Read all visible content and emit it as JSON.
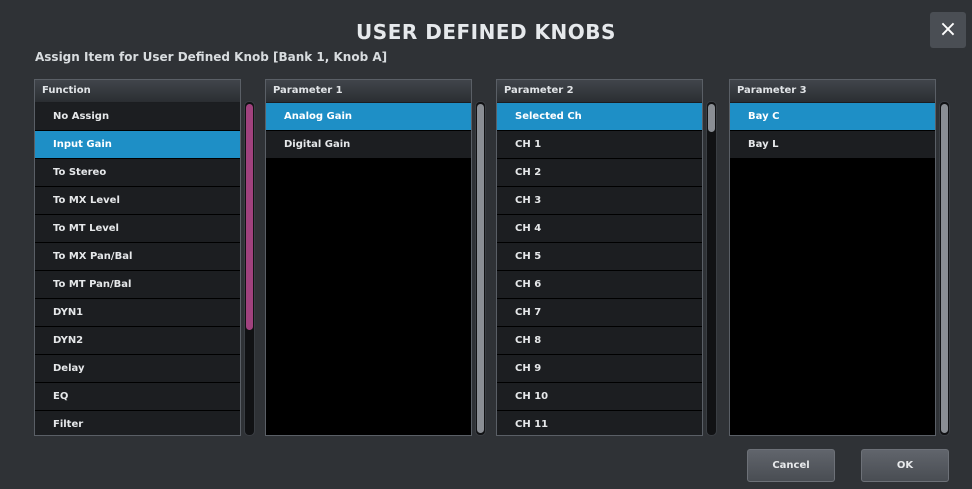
{
  "dialog": {
    "title": "USER DEFINED KNOBS",
    "close_label": "×",
    "subtitle": "Assign Item for User Defined Knob [Bank 1, Knob A]"
  },
  "columns": {
    "function": {
      "header": "Function",
      "items": [
        "No Assign",
        "Input Gain",
        "To Stereo",
        "To MX Level",
        "To MT Level",
        "To MX Pan/Bal",
        "To MT Pan/Bal",
        "DYN1",
        "DYN2",
        "Delay",
        "EQ",
        "Filter"
      ],
      "selected": "Input Gain"
    },
    "parameter1": {
      "header": "Parameter 1",
      "items": [
        "Analog Gain",
        "Digital Gain"
      ],
      "selected": "Analog Gain"
    },
    "parameter2": {
      "header": "Parameter 2",
      "items": [
        "Selected Ch",
        "CH 1",
        "CH 2",
        "CH 3",
        "CH 4",
        "CH 5",
        "CH 6",
        "CH 7",
        "CH 8",
        "CH 9",
        "CH 10",
        "CH 11"
      ],
      "selected": "Selected Ch"
    },
    "parameter3": {
      "header": "Parameter 3",
      "items": [
        "Bay C",
        "Bay L"
      ],
      "selected": "Bay C"
    }
  },
  "buttons": {
    "cancel": "Cancel",
    "ok": "OK"
  },
  "colors": {
    "selection": "#1e8fc6",
    "function_scroll_thumb": "#a0427e",
    "scroll_thumb": "#8a8e94"
  }
}
